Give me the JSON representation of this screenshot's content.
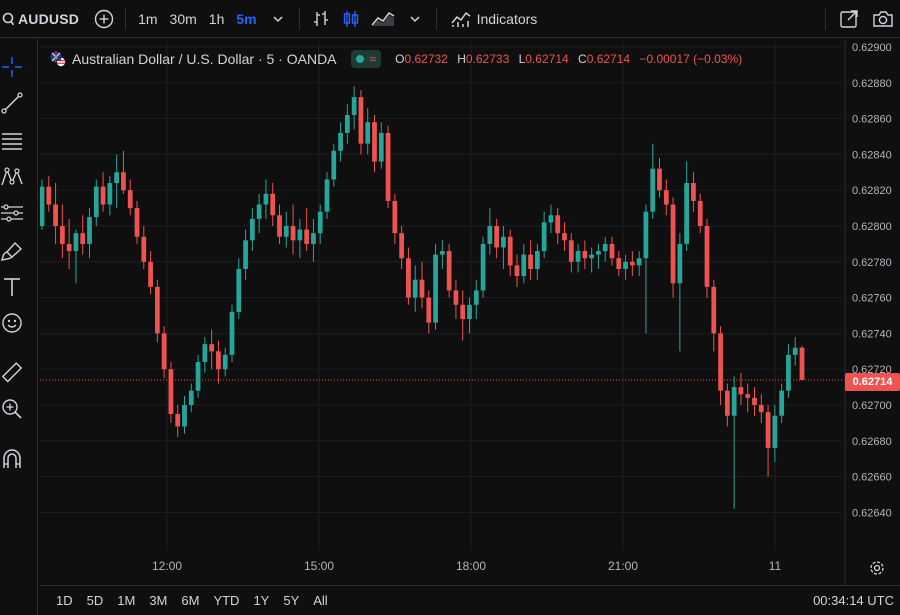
{
  "toolbar": {
    "symbol": "AUDUSD",
    "timeframes": [
      "1m",
      "30m",
      "1h",
      "5m"
    ],
    "active_timeframe": "5m",
    "indicators_label": "Indicators"
  },
  "legend": {
    "title": "Australian Dollar / U.S. Dollar · 5 · OANDA",
    "open_label": "O",
    "open": "0.62732",
    "high_label": "H",
    "high": "0.62733",
    "low_label": "L",
    "low": "0.62714",
    "close_label": "C",
    "close": "0.62714",
    "change": "−0.00017 (−0.03%)",
    "status_glyph": "≈"
  },
  "price_axis": {
    "ticks": [
      "0.62900",
      "0.62880",
      "0.62860",
      "0.62840",
      "0.62820",
      "0.62800",
      "0.62780",
      "0.62760",
      "0.62740",
      "0.62720",
      "0.62700",
      "0.62680",
      "0.62660",
      "0.62640"
    ],
    "current_price": "0.62714"
  },
  "time_axis": {
    "ticks": [
      "12:00",
      "15:00",
      "18:00",
      "21:00",
      "11"
    ]
  },
  "bottom": {
    "ranges": [
      "1D",
      "5D",
      "1M",
      "3M",
      "6M",
      "YTD",
      "1Y",
      "5Y",
      "All"
    ],
    "clock": "00:34:14 UTC"
  },
  "colors": {
    "up": "#26a69a",
    "down": "#ef5350",
    "grid": "#1c1f26",
    "background": "#0f0f0f",
    "accent": "#2962ff"
  },
  "chart_data": {
    "type": "candlestick",
    "ylim": [
      0.6263,
      0.6291
    ],
    "candles": [
      [
        0.628,
        0.62826,
        0.62798,
        0.62822
      ],
      [
        0.62822,
        0.62828,
        0.62808,
        0.62812
      ],
      [
        0.62812,
        0.62824,
        0.6279,
        0.628
      ],
      [
        0.628,
        0.62812,
        0.62782,
        0.6279
      ],
      [
        0.6279,
        0.62804,
        0.62776,
        0.62786
      ],
      [
        0.62786,
        0.62798,
        0.62768,
        0.62796
      ],
      [
        0.62796,
        0.62806,
        0.62784,
        0.6279
      ],
      [
        0.6279,
        0.6281,
        0.62782,
        0.62805
      ],
      [
        0.62805,
        0.62826,
        0.628,
        0.62822
      ],
      [
        0.62822,
        0.6283,
        0.62808,
        0.62812
      ],
      [
        0.62812,
        0.62828,
        0.62806,
        0.62824
      ],
      [
        0.62824,
        0.6284,
        0.6281,
        0.6283
      ],
      [
        0.6283,
        0.62842,
        0.62818,
        0.6282
      ],
      [
        0.6282,
        0.62826,
        0.62806,
        0.6281
      ],
      [
        0.6281,
        0.62814,
        0.6279,
        0.62794
      ],
      [
        0.62794,
        0.628,
        0.62776,
        0.6278
      ],
      [
        0.6278,
        0.62786,
        0.62762,
        0.62766
      ],
      [
        0.62766,
        0.6277,
        0.62735,
        0.6274
      ],
      [
        0.6274,
        0.62744,
        0.62715,
        0.6272
      ],
      [
        0.6272,
        0.62724,
        0.6269,
        0.62695
      ],
      [
        0.62695,
        0.627,
        0.62682,
        0.62688
      ],
      [
        0.62688,
        0.62705,
        0.62684,
        0.627
      ],
      [
        0.627,
        0.62712,
        0.62696,
        0.62708
      ],
      [
        0.62708,
        0.62728,
        0.62704,
        0.62724
      ],
      [
        0.62724,
        0.62738,
        0.62718,
        0.62734
      ],
      [
        0.62734,
        0.62742,
        0.6272,
        0.6273
      ],
      [
        0.6273,
        0.62736,
        0.62712,
        0.6272
      ],
      [
        0.6272,
        0.62732,
        0.62716,
        0.62728
      ],
      [
        0.62728,
        0.62756,
        0.62724,
        0.62752
      ],
      [
        0.62752,
        0.62782,
        0.62748,
        0.62776
      ],
      [
        0.62776,
        0.62798,
        0.6277,
        0.62792
      ],
      [
        0.62792,
        0.6281,
        0.62786,
        0.62804
      ],
      [
        0.62804,
        0.62818,
        0.62796,
        0.62812
      ],
      [
        0.62812,
        0.62826,
        0.62804,
        0.62818
      ],
      [
        0.62818,
        0.62824,
        0.628,
        0.62806
      ],
      [
        0.62806,
        0.62812,
        0.6279,
        0.62794
      ],
      [
        0.62794,
        0.62808,
        0.62788,
        0.628
      ],
      [
        0.628,
        0.62812,
        0.62784,
        0.62792
      ],
      [
        0.62792,
        0.62804,
        0.62782,
        0.62798
      ],
      [
        0.62798,
        0.6281,
        0.62786,
        0.6279
      ],
      [
        0.6279,
        0.62804,
        0.6278,
        0.62796
      ],
      [
        0.62796,
        0.62812,
        0.6279,
        0.62808
      ],
      [
        0.62808,
        0.6283,
        0.62804,
        0.62826
      ],
      [
        0.62826,
        0.62846,
        0.62822,
        0.62842
      ],
      [
        0.62842,
        0.62858,
        0.62836,
        0.62852
      ],
      [
        0.62852,
        0.62868,
        0.62846,
        0.62862
      ],
      [
        0.62862,
        0.62878,
        0.62854,
        0.62872
      ],
      [
        0.62872,
        0.62876,
        0.6284,
        0.62846
      ],
      [
        0.62846,
        0.62866,
        0.6284,
        0.62858
      ],
      [
        0.62858,
        0.62862,
        0.6283,
        0.62836
      ],
      [
        0.62836,
        0.62858,
        0.62832,
        0.62852
      ],
      [
        0.62852,
        0.62856,
        0.6281,
        0.62814
      ],
      [
        0.62814,
        0.62818,
        0.6279,
        0.62796
      ],
      [
        0.62796,
        0.628,
        0.62776,
        0.62782
      ],
      [
        0.62782,
        0.62788,
        0.62756,
        0.6276
      ],
      [
        0.6276,
        0.62778,
        0.62752,
        0.6277
      ],
      [
        0.6277,
        0.6278,
        0.62754,
        0.6276
      ],
      [
        0.6276,
        0.62764,
        0.6274,
        0.62746
      ],
      [
        0.62746,
        0.6279,
        0.62742,
        0.62784
      ],
      [
        0.62784,
        0.62792,
        0.62776,
        0.62786
      ],
      [
        0.62786,
        0.6279,
        0.6276,
        0.62764
      ],
      [
        0.62764,
        0.6277,
        0.62748,
        0.62756
      ],
      [
        0.62756,
        0.62764,
        0.62736,
        0.62748
      ],
      [
        0.62748,
        0.6276,
        0.6274,
        0.62756
      ],
      [
        0.62756,
        0.6277,
        0.62748,
        0.62764
      ],
      [
        0.62764,
        0.62794,
        0.6276,
        0.6279
      ],
      [
        0.6279,
        0.6281,
        0.62784,
        0.628
      ],
      [
        0.628,
        0.62804,
        0.62782,
        0.62788
      ],
      [
        0.62788,
        0.628,
        0.62776,
        0.62794
      ],
      [
        0.62794,
        0.62798,
        0.62772,
        0.62778
      ],
      [
        0.62778,
        0.62784,
        0.62766,
        0.62772
      ],
      [
        0.62772,
        0.6279,
        0.62768,
        0.62784
      ],
      [
        0.62784,
        0.62792,
        0.6277,
        0.62776
      ],
      [
        0.62776,
        0.6279,
        0.6277,
        0.62786
      ],
      [
        0.62786,
        0.62808,
        0.62782,
        0.62802
      ],
      [
        0.62802,
        0.62812,
        0.62796,
        0.62806
      ],
      [
        0.62806,
        0.6281,
        0.6279,
        0.62796
      ],
      [
        0.62796,
        0.62802,
        0.62786,
        0.62792
      ],
      [
        0.62792,
        0.62796,
        0.62774,
        0.6278
      ],
      [
        0.6278,
        0.6279,
        0.62774,
        0.62786
      ],
      [
        0.62786,
        0.62792,
        0.62776,
        0.62782
      ],
      [
        0.62782,
        0.62788,
        0.62774,
        0.62784
      ],
      [
        0.62784,
        0.6279,
        0.62776,
        0.62786
      ],
      [
        0.62786,
        0.62794,
        0.6278,
        0.6279
      ],
      [
        0.6279,
        0.62794,
        0.62778,
        0.62782
      ],
      [
        0.62782,
        0.62786,
        0.62772,
        0.62776
      ],
      [
        0.62776,
        0.62784,
        0.6277,
        0.6278
      ],
      [
        0.6278,
        0.62786,
        0.62772,
        0.62778
      ],
      [
        0.62778,
        0.62786,
        0.62772,
        0.62782
      ],
      [
        0.62782,
        0.62812,
        0.6274,
        0.62808
      ],
      [
        0.62808,
        0.62846,
        0.62804,
        0.62832
      ],
      [
        0.62832,
        0.62838,
        0.62816,
        0.6282
      ],
      [
        0.6282,
        0.62826,
        0.62806,
        0.62812
      ],
      [
        0.62812,
        0.62816,
        0.6276,
        0.62768
      ],
      [
        0.62768,
        0.62796,
        0.6273,
        0.6279
      ],
      [
        0.6279,
        0.62836,
        0.62786,
        0.62824
      ],
      [
        0.62824,
        0.6283,
        0.62808,
        0.62814
      ],
      [
        0.62814,
        0.62818,
        0.62796,
        0.628
      ],
      [
        0.628,
        0.62804,
        0.6276,
        0.62766
      ],
      [
        0.62766,
        0.6277,
        0.6273,
        0.6274
      ],
      [
        0.6274,
        0.62744,
        0.627,
        0.62708
      ],
      [
        0.62708,
        0.62712,
        0.62688,
        0.62694
      ],
      [
        0.62694,
        0.62716,
        0.62642,
        0.6271
      ],
      [
        0.6271,
        0.62718,
        0.627,
        0.62706
      ],
      [
        0.62706,
        0.62712,
        0.62696,
        0.62704
      ],
      [
        0.62704,
        0.6271,
        0.62694,
        0.627
      ],
      [
        0.627,
        0.62706,
        0.6269,
        0.62696
      ],
      [
        0.62696,
        0.627,
        0.6266,
        0.62676
      ],
      [
        0.62676,
        0.627,
        0.62668,
        0.62694
      ],
      [
        0.62694,
        0.62712,
        0.6269,
        0.62708
      ],
      [
        0.62708,
        0.62734,
        0.62704,
        0.62728
      ],
      [
        0.62728,
        0.62738,
        0.62722,
        0.62732
      ],
      [
        0.62732,
        0.62733,
        0.62714,
        0.62714
      ]
    ]
  }
}
